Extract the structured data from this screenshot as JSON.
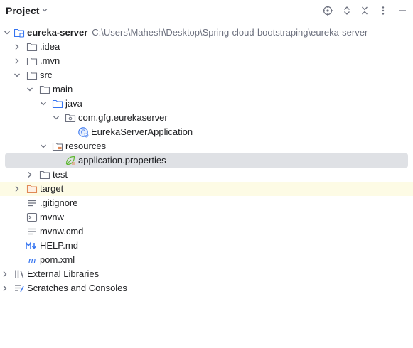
{
  "panel": {
    "title": "Project",
    "actions": [
      "locate-icon",
      "expand-collapse-icon",
      "collapse-all-icon",
      "more-options-icon"
    ]
  },
  "tree": {
    "root": {
      "label": "eureka-server",
      "path": "C:\\Users\\Mahesh\\Desktop\\Spring-cloud-bootstraping\\eureka-server"
    },
    "idea": ".idea",
    "mvn": ".mvn",
    "src": "src",
    "main": "main",
    "java": "java",
    "package": "com.gfg.eurekaserver",
    "app_class": "EurekaServerApplication",
    "resources": "resources",
    "app_props": "application.properties",
    "test": "test",
    "target": "target",
    "gitignore": ".gitignore",
    "mvnw": "mvnw",
    "mvnw_cmd": "mvnw.cmd",
    "help_md": "HELP.md",
    "pom": "pom.xml",
    "ext_libs": "External Libraries",
    "scratches": "Scratches and Consoles"
  },
  "colors": {
    "selected_row": "#dfe1e5",
    "highlighted_row": "#fdfbe5",
    "folder_blue": "#3574f0",
    "folder_orange": "#e08855",
    "path_gray": "#6c707e"
  }
}
